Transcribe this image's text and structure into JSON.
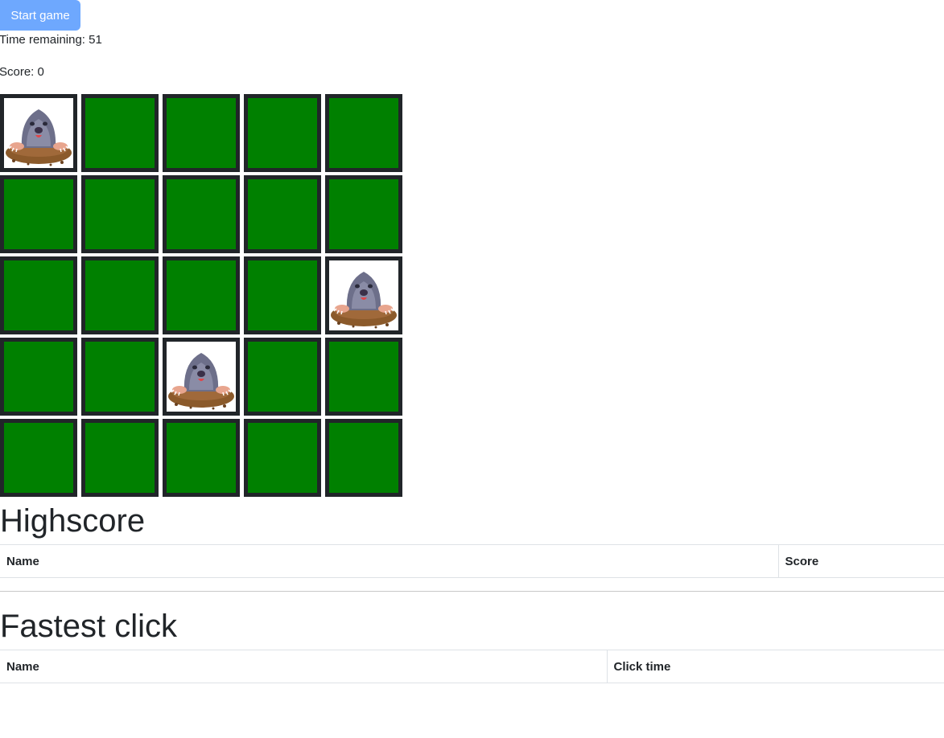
{
  "controls": {
    "start_label": "Start game",
    "time_text": "Time remaining: 51",
    "score_text": "Score: 0"
  },
  "board": {
    "rows": 5,
    "cols": 5,
    "cell_color": "#008000",
    "border_color": "#212529",
    "moles": [
      [
        0,
        0
      ],
      [
        2,
        4
      ],
      [
        3,
        2
      ]
    ]
  },
  "highscore": {
    "title": "Highscore",
    "columns": [
      "Name",
      "Score"
    ]
  },
  "fastest_click": {
    "title": "Fastest click",
    "columns": [
      "Name",
      "Click time"
    ]
  }
}
